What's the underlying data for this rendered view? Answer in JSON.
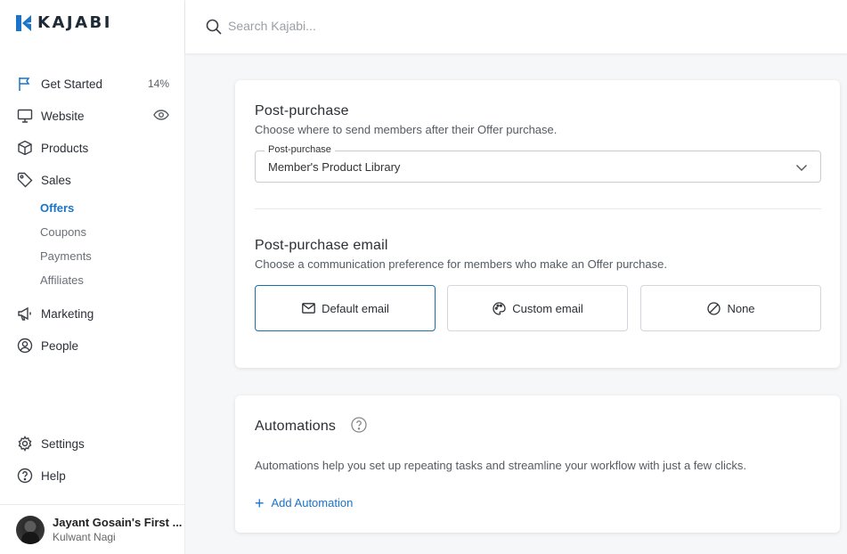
{
  "brand": {
    "name": "KAJABI",
    "accent": "#1a73c9"
  },
  "search": {
    "placeholder": "Search Kajabi..."
  },
  "sidebar": {
    "items": [
      {
        "label": "Get Started",
        "trail": "14%",
        "icon": "flag-icon"
      },
      {
        "label": "Website",
        "icon": "monitor-icon",
        "trail_icon": "eye-icon"
      },
      {
        "label": "Products",
        "icon": "box-icon"
      },
      {
        "label": "Sales",
        "icon": "tag-icon"
      }
    ],
    "sales_sub": [
      "Offers",
      "Coupons",
      "Payments",
      "Affiliates"
    ],
    "more_items": [
      {
        "label": "Marketing",
        "icon": "megaphone-icon"
      },
      {
        "label": "People",
        "icon": "person-icon"
      }
    ],
    "bottom_items": [
      {
        "label": "Settings",
        "icon": "gear-icon"
      },
      {
        "label": "Help",
        "icon": "question-icon"
      }
    ],
    "account": {
      "name": "Jayant Gosain's First ...",
      "sub": "Kulwant Nagi"
    }
  },
  "post_purchase": {
    "title": "Post-purchase",
    "description": "Choose where to send members after their Offer purchase.",
    "select_label": "Post-purchase",
    "select_value": "Member's Product Library"
  },
  "post_purchase_email": {
    "title": "Post-purchase email",
    "description": "Choose a communication preference for members who make an Offer purchase.",
    "options": [
      {
        "label": "Default email",
        "icon": "envelope-icon",
        "selected": true
      },
      {
        "label": "Custom email",
        "icon": "palette-icon",
        "selected": false
      },
      {
        "label": "None",
        "icon": "block-icon",
        "selected": false
      }
    ]
  },
  "automations": {
    "title": "Automations",
    "description": "Automations help you set up repeating tasks and streamline your workflow with just a few clicks.",
    "add_label": "Add Automation"
  }
}
